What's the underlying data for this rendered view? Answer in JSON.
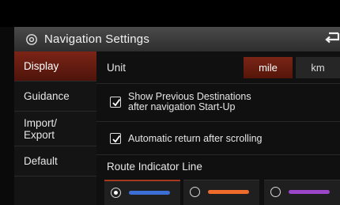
{
  "header": {
    "title": "Navigation Settings"
  },
  "sidebar": {
    "items": [
      {
        "label": "Display",
        "active": true
      },
      {
        "label": "Guidance",
        "active": false
      },
      {
        "label_line1": "Import/",
        "label_line2": "Export",
        "active": false
      },
      {
        "label": "Default",
        "active": false
      }
    ]
  },
  "unit": {
    "label": "Unit",
    "options": [
      {
        "label": "mile",
        "selected": true
      },
      {
        "label": "km",
        "selected": false
      }
    ]
  },
  "options": {
    "show_previous": {
      "line1": "Show Previous Destinations",
      "line2": "after navigation Start-Up",
      "checked": true
    },
    "auto_return": {
      "label": "Automatic return after scrolling",
      "checked": true
    }
  },
  "route_indicator": {
    "label": "Route Indicator Line",
    "choices": [
      {
        "color": "#3b6fd6",
        "selected": true
      },
      {
        "color": "#ef6b2c",
        "selected": false
      },
      {
        "color": "#9b45c9",
        "selected": false
      }
    ]
  },
  "colors": {
    "accent": "#7b2416",
    "header_bg": "#3c3c3c",
    "background": "#101010"
  },
  "icons": {
    "header_left": "gear-icon",
    "header_right": "back-arrow-icon",
    "checkbox": "checkmark-icon"
  }
}
